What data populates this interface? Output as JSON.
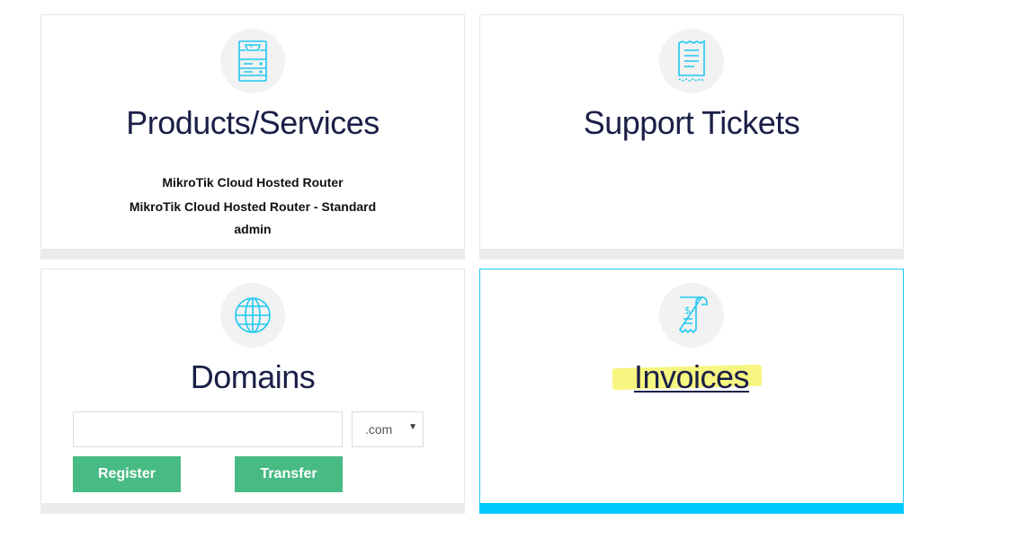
{
  "cards": {
    "products": {
      "title": "Products/Services",
      "icon": "server-icon",
      "lines": [
        "MikroTik Cloud Hosted Router",
        "MikroTik Cloud Hosted Router - Standard",
        "admin"
      ]
    },
    "tickets": {
      "title": "Support Tickets",
      "icon": "receipt-icon"
    },
    "domains": {
      "title": "Domains",
      "icon": "globe-icon",
      "input_value": "",
      "tld_selected": ".com",
      "register_label": "Register",
      "transfer_label": "Transfer"
    },
    "invoices": {
      "title": "Invoices",
      "icon": "invoice-icon"
    }
  },
  "colors": {
    "title": "#1b1f47",
    "icon": "#1ec8f0",
    "button": "#48bb84",
    "active_accent": "#00c8ff",
    "highlight": "#f5f56a"
  }
}
